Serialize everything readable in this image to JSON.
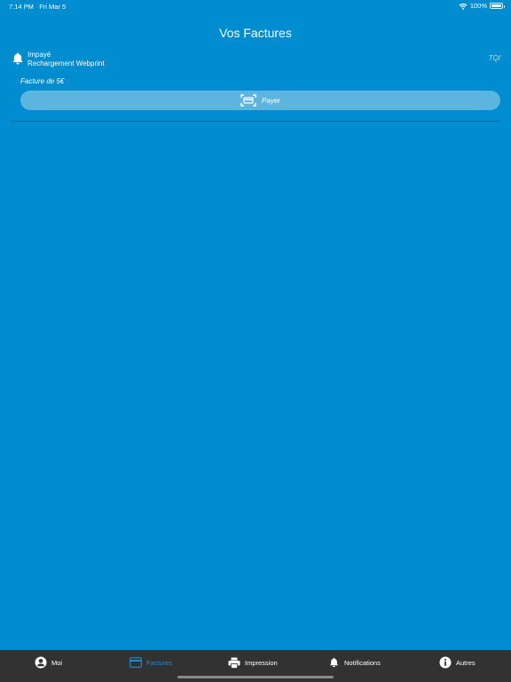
{
  "status_bar": {
    "time": "7:14 PM",
    "date": "Fri Mar 5",
    "battery": "100%",
    "battery_level": 1.0
  },
  "page": {
    "title": "Vos Factures"
  },
  "invoices": [
    {
      "status": "Impayé",
      "label": "Rechargement Webprint",
      "tag": "TQI",
      "amount": "Facture de 5€",
      "pay_label": "Payer"
    }
  ],
  "tab_bar": {
    "items": [
      {
        "label": "Moi",
        "icon": "person-circle-icon"
      },
      {
        "label": "Factures",
        "icon": "credit-card-icon",
        "active": true
      },
      {
        "label": "Impression",
        "icon": "printer-icon"
      },
      {
        "label": "Notifications",
        "icon": "bell-icon"
      },
      {
        "label": "Autres",
        "icon": "info-circle-icon"
      }
    ]
  },
  "colors": {
    "background": "#008DCF",
    "button": "#5CB5DF",
    "tab_bar": "#323232",
    "tab_active": "#1B8AD1"
  }
}
